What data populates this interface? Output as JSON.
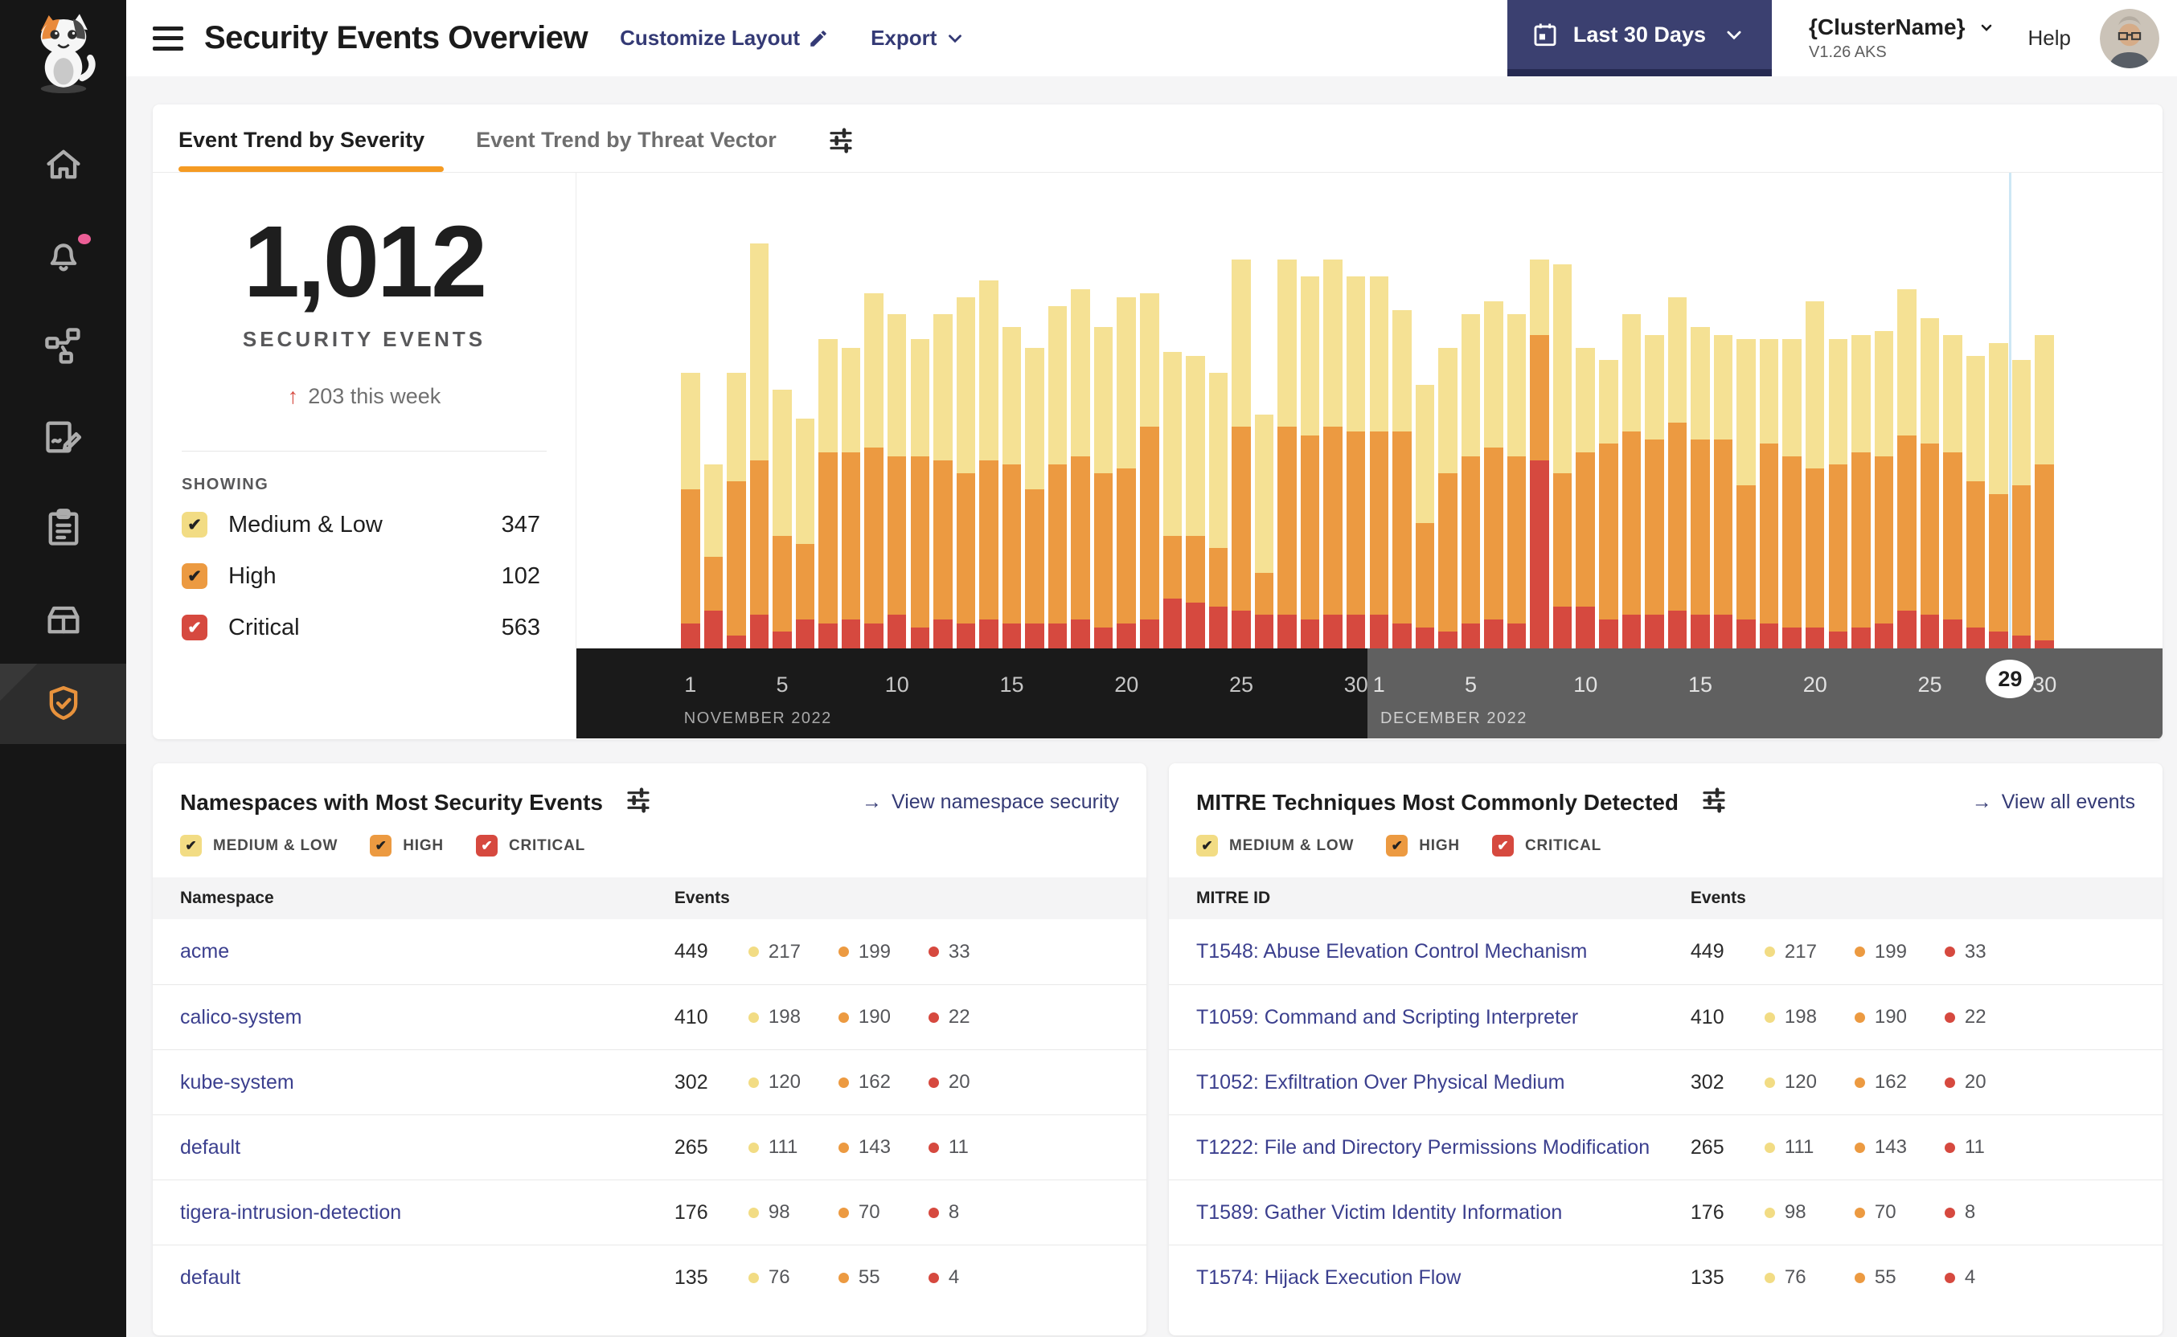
{
  "sidebar": {
    "items": [
      "home-icon",
      "alerts-bell-icon",
      "service-graph-icon",
      "policy-edit-icon",
      "compliance-clipboard-icon",
      "catalog-box-icon",
      "security-shield-icon"
    ],
    "active": "security-shield-icon"
  },
  "header": {
    "title": "Security Events Overview",
    "customize_layout": "Customize Layout",
    "export": "Export",
    "date_range": "Last 30 Days",
    "cluster_name": "{ClusterName}",
    "cluster_version": "V1.26 AKS",
    "help": "Help"
  },
  "tabs": {
    "active": "Event Trend by Severity",
    "inactive": "Event Trend by Threat Vector"
  },
  "summary": {
    "total": "1,012",
    "label": "SECURITY EVENTS",
    "delta_arrow": "↑",
    "delta": "203 this week",
    "showing": "SHOWING",
    "filters": [
      {
        "label": "Medium & Low",
        "count": "347",
        "color": "#F2DC84",
        "check": "#222222"
      },
      {
        "label": "High",
        "count": "102",
        "color": "#EC9A41",
        "check": "#222222"
      },
      {
        "label": "Critical",
        "count": "563",
        "color": "#D6493F",
        "check": "#FFFFFF"
      }
    ]
  },
  "severity_chips": [
    {
      "label": "MEDIUM & LOW",
      "color": "#F2DC84",
      "check": "#222222"
    },
    {
      "label": "HIGH",
      "color": "#EC9A41",
      "check": "#222222"
    },
    {
      "label": "CRITICAL",
      "color": "#D6493F",
      "check": "#FFFFFF"
    }
  ],
  "severity_colors": {
    "medlow": "#F2DC84",
    "high": "#EC9A41",
    "critical": "#D6493F"
  },
  "namespaces_card": {
    "title": "Namespaces with Most Security Events",
    "link_arrow": "→",
    "link": "View namespace security",
    "columns": {
      "name": "Namespace",
      "events": "Events"
    },
    "rows": [
      {
        "name": "acme",
        "total": "449",
        "medlow": "217",
        "high": "199",
        "critical": "33"
      },
      {
        "name": "calico-system",
        "total": "410",
        "medlow": "198",
        "high": "190",
        "critical": "22"
      },
      {
        "name": "kube-system",
        "total": "302",
        "medlow": "120",
        "high": "162",
        "critical": "20"
      },
      {
        "name": "default",
        "total": "265",
        "medlow": "111",
        "high": "143",
        "critical": "11"
      },
      {
        "name": "tigera-intrusion-detection",
        "total": "176",
        "medlow": "98",
        "high": "70",
        "critical": "8"
      },
      {
        "name": "default",
        "total": "135",
        "medlow": "76",
        "high": "55",
        "critical": "4"
      }
    ]
  },
  "mitre_card": {
    "title": "MITRE Techniques Most Commonly Detected",
    "link_arrow": "→",
    "link": "View all events",
    "columns": {
      "name": "MITRE ID",
      "events": "Events"
    },
    "rows": [
      {
        "name": "T1548: Abuse Elevation Control Mechanism",
        "total": "449",
        "medlow": "217",
        "high": "199",
        "critical": "33"
      },
      {
        "name": "T1059: Command and Scripting Interpreter",
        "total": "410",
        "medlow": "198",
        "high": "190",
        "critical": "22"
      },
      {
        "name": "T1052: Exfiltration Over Physical Medium",
        "total": "302",
        "medlow": "120",
        "high": "162",
        "critical": "20"
      },
      {
        "name": "T1222: File and Directory Permissions Modification",
        "total": "265",
        "medlow": "111",
        "high": "143",
        "critical": "11"
      },
      {
        "name": "T1589: Gather Victim Identity Information",
        "total": "176",
        "medlow": "98",
        "high": "70",
        "critical": "8"
      },
      {
        "name": "T1574: Hijack Execution Flow",
        "total": "135",
        "medlow": "76",
        "high": "55",
        "critical": "4"
      }
    ]
  },
  "chart_data": {
    "type": "bar",
    "subtype": "stacked-daily-severity",
    "title": "Event Trend by Severity",
    "note": "y-axis not shown; values are relative daily event heights estimated from pixels (0-100 scale)",
    "ylim": [
      0,
      100
    ],
    "x": [
      "Nov 1",
      "Nov 2",
      "Nov 3",
      "Nov 4",
      "Nov 5",
      "Nov 6",
      "Nov 7",
      "Nov 8",
      "Nov 9",
      "Nov 10",
      "Nov 11",
      "Nov 12",
      "Nov 13",
      "Nov 14",
      "Nov 15",
      "Nov 16",
      "Nov 17",
      "Nov 18",
      "Nov 19",
      "Nov 20",
      "Nov 21",
      "Nov 22",
      "Nov 23",
      "Nov 24",
      "Nov 25",
      "Nov 26",
      "Nov 27",
      "Nov 28",
      "Nov 29",
      "Nov 30",
      "Dec 1",
      "Dec 2",
      "Dec 3",
      "Dec 4",
      "Dec 5",
      "Dec 6",
      "Dec 7",
      "Dec 8",
      "Dec 9",
      "Dec 10",
      "Dec 11",
      "Dec 12",
      "Dec 13",
      "Dec 14",
      "Dec 15",
      "Dec 16",
      "Dec 17",
      "Dec 18",
      "Dec 19",
      "Dec 20",
      "Dec 21",
      "Dec 22",
      "Dec 23",
      "Dec 24",
      "Dec 25",
      "Dec 26",
      "Dec 27",
      "Dec 28",
      "Dec 29",
      "Dec 30"
    ],
    "series": [
      {
        "name": "Medium & Low",
        "color": "#F5E194",
        "values": [
          28,
          22,
          26,
          52,
          35,
          30,
          27,
          25,
          37,
          34,
          28,
          35,
          42,
          43,
          33,
          34,
          38,
          40,
          35,
          41,
          32,
          44,
          43,
          42,
          40,
          38,
          40,
          38,
          40,
          37,
          37,
          29,
          33,
          30,
          34,
          35,
          34,
          18,
          50,
          25,
          20,
          28,
          25,
          30,
          27,
          25,
          35,
          25,
          28,
          40,
          30,
          28,
          30,
          35,
          30,
          28,
          30,
          36,
          30,
          31
        ]
      },
      {
        "name": "High",
        "color": "#EC9A41",
        "values": [
          32,
          13,
          37,
          37,
          23,
          18,
          41,
          40,
          42,
          38,
          41,
          38,
          36,
          38,
          38,
          32,
          38,
          39,
          37,
          37,
          46,
          15,
          16,
          14,
          44,
          10,
          45,
          44,
          45,
          44,
          44,
          46,
          25,
          38,
          40,
          41,
          40,
          30,
          32,
          37,
          42,
          44,
          42,
          45,
          42,
          42,
          32,
          43,
          41,
          38,
          40,
          42,
          40,
          42,
          41,
          40,
          35,
          33,
          36,
          42
        ]
      },
      {
        "name": "Critical",
        "color": "#D6493F",
        "values": [
          6,
          9,
          3,
          8,
          4,
          7,
          6,
          7,
          6,
          8,
          5,
          7,
          6,
          7,
          6,
          6,
          6,
          7,
          5,
          6,
          7,
          12,
          11,
          10,
          9,
          8,
          8,
          7,
          8,
          8,
          8,
          6,
          5,
          4,
          6,
          7,
          6,
          45,
          10,
          10,
          7,
          8,
          8,
          9,
          8,
          8,
          7,
          6,
          5,
          5,
          4,
          5,
          6,
          9,
          8,
          7,
          5,
          4,
          3,
          2
        ]
      }
    ],
    "stack_order_bottom_to_top": [
      "Critical",
      "High",
      "Medium & Low"
    ],
    "legend_position": "none (legend lives in left summary panel)",
    "grid": false,
    "axis": {
      "months": [
        {
          "label": "NOVEMBER 2022",
          "bg": "#1A1A1A",
          "ticks": [
            "1",
            "5",
            "10",
            "15",
            "20",
            "25",
            "30"
          ],
          "tick_day_indices": [
            0,
            4,
            9,
            14,
            19,
            24,
            29
          ]
        },
        {
          "label": "DECEMBER 2022",
          "bg": "#606060",
          "ticks": [
            "1",
            "5",
            "10",
            "15",
            "20",
            "25",
            "30"
          ],
          "tick_day_indices": [
            30,
            34,
            39,
            44,
            49,
            54,
            59
          ]
        }
      ],
      "selected_day": {
        "label": "29",
        "day_index": 58,
        "marker_line_color": "#CDE7F5"
      }
    }
  }
}
